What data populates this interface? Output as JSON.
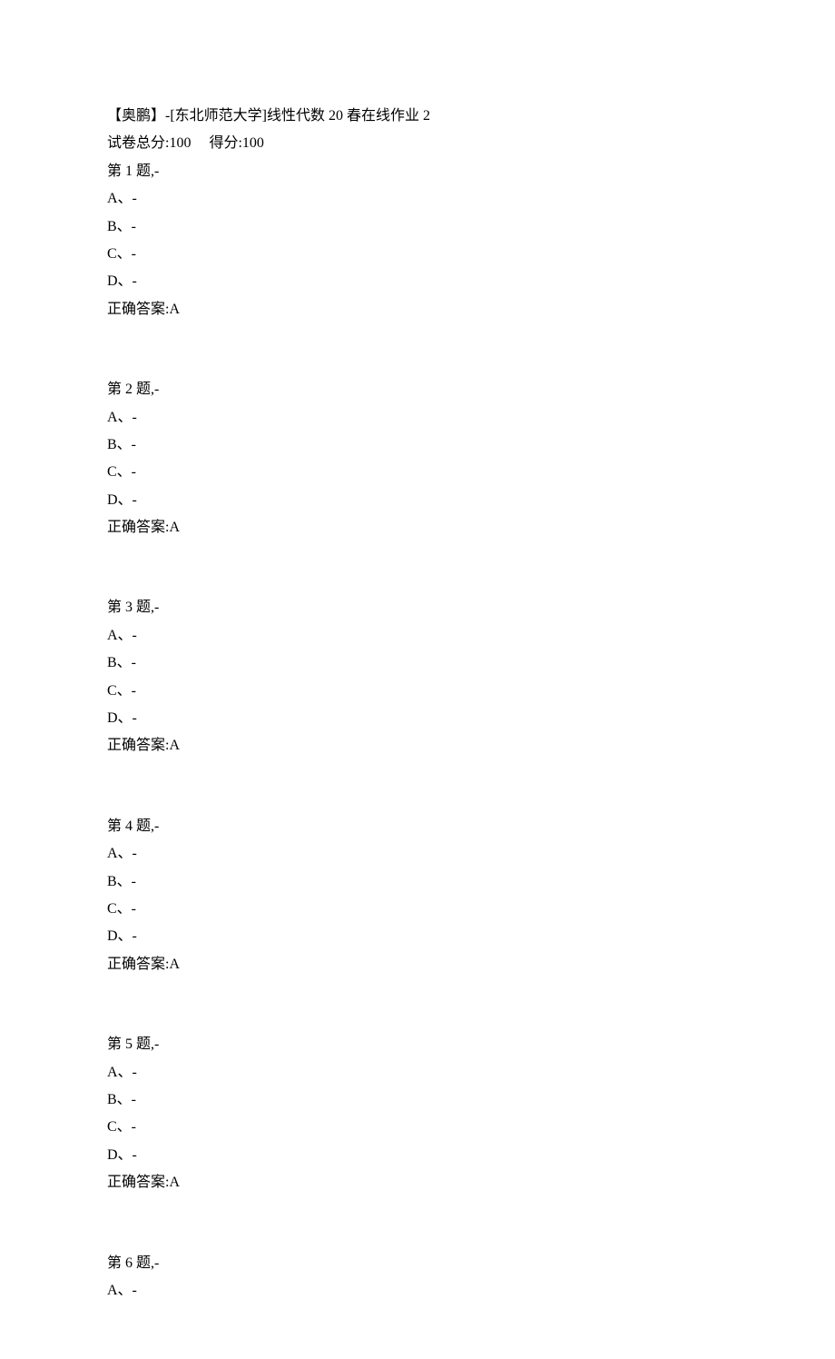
{
  "header": {
    "title": "【奥鹏】-[东北师范大学]线性代数 20 春在线作业 2",
    "score_label": "试卷总分:100",
    "score_gap": "     ",
    "obtained_label": "得分:100"
  },
  "questions": [
    {
      "title": "第 1 题,-",
      "options": [
        "A、-",
        "B、-",
        "C、-",
        "D、-"
      ],
      "answer": "正确答案:A"
    },
    {
      "title": "第 2 题,-",
      "options": [
        "A、-",
        "B、-",
        "C、-",
        "D、-"
      ],
      "answer": "正确答案:A"
    },
    {
      "title": "第 3 题,-",
      "options": [
        "A、-",
        "B、-",
        "C、-",
        "D、-"
      ],
      "answer": "正确答案:A"
    },
    {
      "title": "第 4 题,-",
      "options": [
        "A、-",
        "B、-",
        "C、-",
        "D、-"
      ],
      "answer": "正确答案:A"
    },
    {
      "title": "第 5 题,-",
      "options": [
        "A、-",
        "B、-",
        "C、-",
        "D、-"
      ],
      "answer": "正确答案:A"
    },
    {
      "title": "第 6 题,-",
      "options": [
        "A、-"
      ],
      "answer": null
    }
  ]
}
